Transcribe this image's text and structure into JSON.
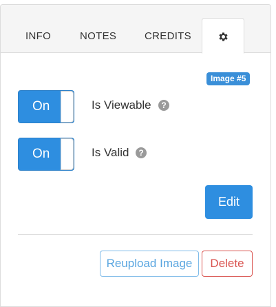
{
  "tabs": {
    "info": "INFO",
    "notes": "NOTES",
    "credits": "CREDITS",
    "settings_icon": "gear-icon"
  },
  "badge": "Image #5",
  "settings": [
    {
      "label": "Is Viewable",
      "toggle_text": "On",
      "help": "?"
    },
    {
      "label": "Is Valid",
      "toggle_text": "On",
      "help": "?"
    }
  ],
  "actions": {
    "edit": "Edit",
    "reupload": "Reupload Image",
    "delete": "Delete"
  },
  "colors": {
    "primary": "#2e8ee0",
    "danger": "#d9534f",
    "badge": "#3a8fd8",
    "help_icon": "#9a9a9a"
  }
}
